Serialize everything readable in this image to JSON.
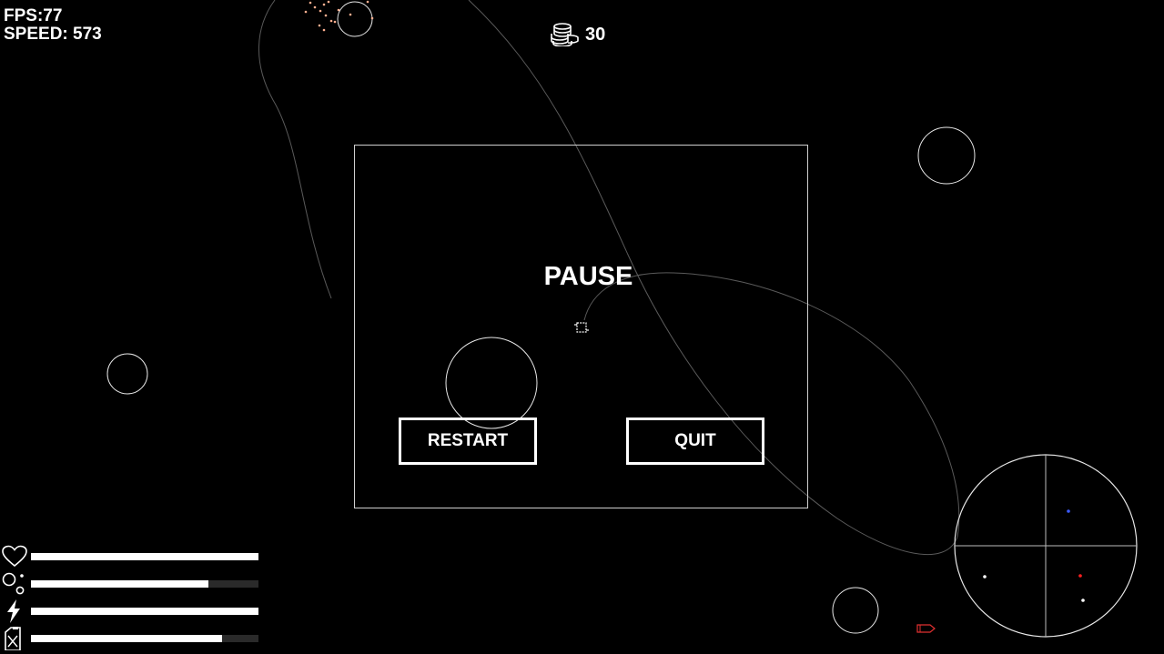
{
  "hud": {
    "fps_text": "FPS:77",
    "speed_text": "SPEED: 573"
  },
  "coins": {
    "icon": "coin-stack-icon",
    "count": "30"
  },
  "pause_menu": {
    "title": "PAUSE",
    "restart_label": "RESTART",
    "quit_label": "QUIT"
  },
  "stats": {
    "health": {
      "icon": "heart-icon",
      "fraction": 1.0
    },
    "oxygen": {
      "icon": "bubbles-icon",
      "fraction": 0.78
    },
    "energy": {
      "icon": "lightning-icon",
      "fraction": 1.0
    },
    "fuel": {
      "icon": "fuel-can-icon",
      "fraction": 0.84
    }
  },
  "radar": {
    "icon": "radar-icon",
    "blips": [
      {
        "color": "#3b5bff",
        "kind": "blue-blip"
      },
      {
        "color": "#ff2020",
        "kind": "red-blip"
      },
      {
        "color": "#ffffff",
        "kind": "white-blip"
      },
      {
        "color": "#ffffff",
        "kind": "white-blip"
      }
    ]
  },
  "colors": {
    "background": "#000000",
    "foreground": "#ffffff",
    "orbit_trail": "#5a5a5a",
    "enemy": "#e03030",
    "debris": "#ffb090"
  }
}
